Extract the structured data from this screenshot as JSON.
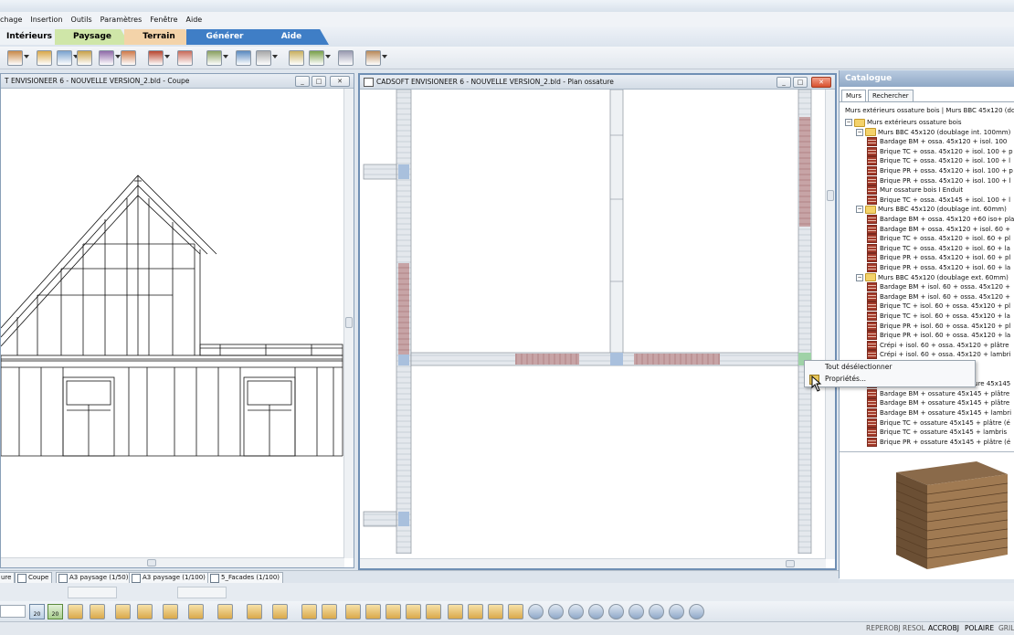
{
  "menu": [
    "chage",
    "Insertion",
    "Outils",
    "Paramètres",
    "Fenêtre",
    "Aide"
  ],
  "ribbon_tabs": [
    {
      "label": "Intérieurs",
      "color": "#eef2f6",
      "text": "#000"
    },
    {
      "label": "Paysage",
      "color": "#cfe6a8",
      "text": "#000"
    },
    {
      "label": "Terrain",
      "color": "#f3d3a9",
      "text": "#000"
    },
    {
      "label": "Générer",
      "color": "#3f7ec6",
      "text": "#ffffff"
    },
    {
      "label": "Aide",
      "color": "#3f7ec6",
      "text": "#ffffff"
    }
  ],
  "left_window": {
    "title": "T ENVISIONEER 6 - NOUVELLE VERSION_2.bld - Coupe"
  },
  "middle_window": {
    "title": "CADSOFT ENVISIONEER 6 - NOUVELLE VERSION_2.bld - Plan ossature"
  },
  "window_buttons": {
    "min": "_",
    "max": "□",
    "close": "✕"
  },
  "catalog": {
    "title": "Catalogue",
    "tabs": [
      "Murs",
      "Rechercher"
    ],
    "path": "Murs extérieurs ossature bois | Murs BBC 45x120 (doublag",
    "tree": [
      {
        "label": "Murs extérieurs ossature bois",
        "level": 0,
        "type": "folder",
        "toggle": "−"
      },
      {
        "label": "Murs BBC 45x120 (doublage int. 100mm)",
        "level": 1,
        "type": "folder",
        "toggle": "−"
      },
      {
        "label": "Bardage BM + ossa. 45x120 + isol. 100",
        "level": 2,
        "type": "brick"
      },
      {
        "label": "Brique TC + ossa. 45x120 + isol. 100 + p",
        "level": 2,
        "type": "brick"
      },
      {
        "label": "Brique TC + ossa. 45x120 + isol. 100 + l",
        "level": 2,
        "type": "brick"
      },
      {
        "label": "Brique PR + ossa. 45x120 + isol. 100 + p",
        "level": 2,
        "type": "brick"
      },
      {
        "label": "Brique PR + ossa. 45x120 + isol. 100 + l",
        "level": 2,
        "type": "brick"
      },
      {
        "label": "Mur ossature bois I Enduit",
        "level": 2,
        "type": "brick"
      },
      {
        "label": "Brique TC + ossa. 45x145 + isol. 100 + l",
        "level": 2,
        "type": "brick"
      },
      {
        "label": "Murs BBC 45x120 (doublage int. 60mm)",
        "level": 1,
        "type": "folder",
        "toggle": "−"
      },
      {
        "label": "Bardage BM + ossa. 45x120 +60 iso+ pla",
        "level": 2,
        "type": "brick"
      },
      {
        "label": "Bardage BM + ossa. 45x120 + isol. 60 +",
        "level": 2,
        "type": "brick"
      },
      {
        "label": "Brique TC + ossa. 45x120 + isol. 60 + pl",
        "level": 2,
        "type": "brick"
      },
      {
        "label": "Brique TC + ossa. 45x120 + isol. 60 + la",
        "level": 2,
        "type": "brick"
      },
      {
        "label": "Brique PR + ossa. 45x120 + isol. 60 + pl",
        "level": 2,
        "type": "brick"
      },
      {
        "label": "Brique PR + ossa. 45x120 + isol. 60 + la",
        "level": 2,
        "type": "brick"
      },
      {
        "label": "Murs BBC 45x120 (doublage ext. 60mm)",
        "level": 1,
        "type": "folder",
        "toggle": "−"
      },
      {
        "label": "Bardage BM + isol. 60 + ossa. 45x120 +",
        "level": 2,
        "type": "brick"
      },
      {
        "label": "Bardage BM + isol. 60 + ossa. 45x120 +",
        "level": 2,
        "type": "brick"
      },
      {
        "label": "Brique TC + isol. 60 + ossa. 45x120 + pl",
        "level": 2,
        "type": "brick"
      },
      {
        "label": "Brique TC + isol. 60 + ossa. 45x120 + la",
        "level": 2,
        "type": "brick"
      },
      {
        "label": "Brique PR + isol. 60 + ossa. 45x120 + pl",
        "level": 2,
        "type": "brick"
      },
      {
        "label": "Brique PR + isol. 60 + ossa. 45x120 + la",
        "level": 2,
        "type": "brick"
      },
      {
        "label": "Crépi + isol. 60 + ossa. 45x120 + plâtre",
        "level": 2,
        "type": "brick"
      },
      {
        "label": "Crépi + isol. 60 + ossa. 45x120 + lambri",
        "level": 2,
        "type": "brick"
      },
      {
        "label": "",
        "level": 2,
        "type": "brick"
      },
      {
        "label": "",
        "level": 2,
        "type": "brick"
      },
      {
        "label": "Acrotère Bardage BM + ossature 45x145",
        "level": 2,
        "type": "brick"
      },
      {
        "label": "Bardage BM + ossature 45x145 + plâtre",
        "level": 2,
        "type": "brick"
      },
      {
        "label": "Bardage BM + ossature 45x145 + plâtre",
        "level": 2,
        "type": "brick"
      },
      {
        "label": "Bardage BM + ossature 45x145 + lambri",
        "level": 2,
        "type": "brick"
      },
      {
        "label": "Brique TC + ossature 45x145 + plâtre (é",
        "level": 2,
        "type": "brick"
      },
      {
        "label": "Brique TC + ossature 45x145 + lambris",
        "level": 2,
        "type": "brick"
      },
      {
        "label": "Brique PR + ossature 45x145 + plâtre (é",
        "level": 2,
        "type": "brick"
      }
    ]
  },
  "context_menu": [
    "Tout désélectionner",
    "Propriétés..."
  ],
  "doc_tabs": [
    "ure",
    "Coupe",
    "A3 paysage (1/50)",
    "A3 paysage (1/100)",
    "5_Facades (1/100)"
  ],
  "bottom_toolbar": {
    "scale_1": "20",
    "scale_2": "20"
  },
  "status": [
    {
      "label": "REPEROBJ",
      "active": false
    },
    {
      "label": "RESOL",
      "active": false
    },
    {
      "label": "ACCROBJ",
      "active": true
    },
    {
      "label": "POLAIRE",
      "active": true
    },
    {
      "label": "GRIL",
      "active": false
    }
  ],
  "icons": [
    "wall-icon",
    "door-icon",
    "window-icon",
    "stair-icon",
    "roof-icon",
    "column-icon",
    "beam-icon",
    "layer-icon",
    "zoom-in-icon",
    "zoom-out-icon",
    "pan-icon",
    "hand-icon"
  ]
}
